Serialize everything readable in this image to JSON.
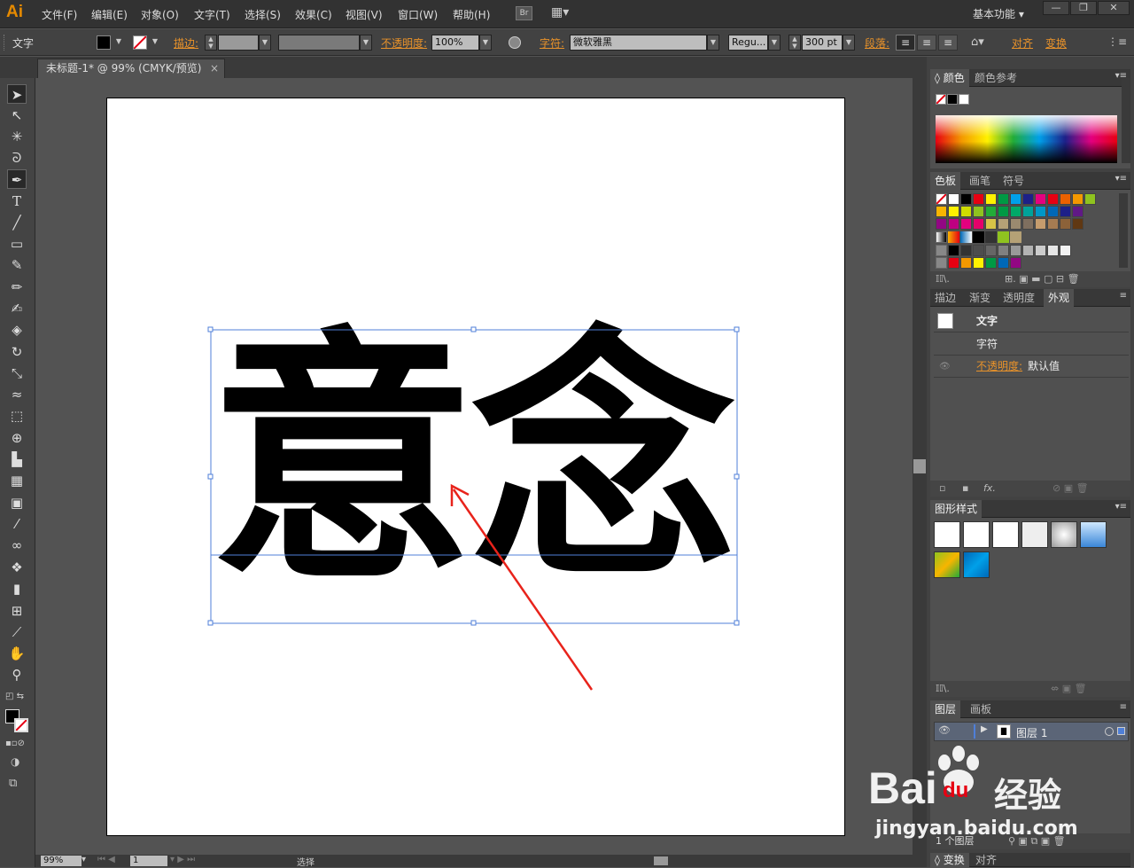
{
  "app": {
    "logo": "Ai"
  },
  "menu": [
    "文件(F)",
    "编辑(E)",
    "对象(O)",
    "文字(T)",
    "选择(S)",
    "效果(C)",
    "视图(V)",
    "窗口(W)",
    "帮助(H)"
  ],
  "menubar_right": {
    "bridge": "Br",
    "workspace": "基本功能",
    "minimize": "—",
    "restore": "❐",
    "close": "✕"
  },
  "control_bar": {
    "tool_label": "文字",
    "stroke_label": "描边:",
    "opacity_label": "不透明度:",
    "opacity_value": "100%",
    "char_label": "字符:",
    "font_name": "微软雅黑",
    "font_style": "Regu...",
    "font_size": "300 pt",
    "paragraph_label": "段落:",
    "align_label": "对齐",
    "transform_label": "变换"
  },
  "document_tab": {
    "title": "未标题-1* @ 99% (CMYK/预览)",
    "close": "×"
  },
  "canvas_text": {
    "glyph1": "意",
    "glyph2": "念"
  },
  "panels": {
    "color": {
      "tabs": [
        "颜色",
        "颜色参考"
      ]
    },
    "swatches": {
      "tabs": [
        "色板",
        "画笔",
        "符号"
      ],
      "row1": [
        "#ffffff",
        "#000000",
        "#e60012",
        "#fff100",
        "#009944",
        "#00a0e9",
        "#1d2088",
        "#e4007f",
        "#e60012",
        "#eb6100",
        "#f39800",
        "#8fc31f"
      ],
      "row2": [
        "#f8b500",
        "#fff100",
        "#cfdb00",
        "#8fc31f",
        "#22ac38",
        "#009944",
        "#00a968",
        "#00a29a",
        "#0097c6",
        "#0068b7",
        "#1d2088",
        "#601986"
      ],
      "row3": [
        "#920783",
        "#be0081",
        "#e4007f",
        "#e5006a",
        "#d7c447",
        "#b5a176",
        "#9b8a6f",
        "#7f6f5f",
        "#c69c6d",
        "#a67c52",
        "#8c6239",
        "#603813"
      ],
      "row4": [
        "#000000",
        "#333333",
        "#4d4d4d",
        "#666666",
        "#808080",
        "#999999",
        "#b3b3b3",
        "#cccccc",
        "#e6e6e6",
        "#f2f2f2"
      ],
      "row5": [
        "#e60012",
        "#f39800",
        "#fff100",
        "#009944",
        "#0068b7",
        "#920783"
      ]
    },
    "appearance": {
      "tabs": [
        "描边",
        "渐变",
        "透明度",
        "外观"
      ],
      "row_text": "文字",
      "row_char": "字符",
      "row_opacity_label": "不透明度:",
      "row_opacity_value": "默认值",
      "fx": "fx."
    },
    "graphic_styles": {
      "title": "图形样式"
    },
    "layers": {
      "tabs": [
        "图层",
        "画板"
      ],
      "layer_name": "图层 1",
      "count": "1 个图层"
    },
    "bottom_tabs": [
      "变换",
      "对齐"
    ]
  },
  "status": {
    "zoom": "99%",
    "page": "1",
    "mode": "选择"
  },
  "watermark": {
    "brand": "Bai",
    "brand2": "du",
    "cn": "经验",
    "url": "jingyan.baidu.com"
  },
  "colors": {
    "accent_orange": "#e68a00",
    "arrow_red": "#e8231b",
    "selection_blue": "#4f7fd8"
  }
}
